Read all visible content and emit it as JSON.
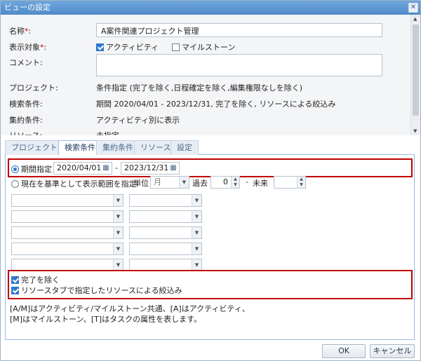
{
  "window": {
    "title": "ビューの設定",
    "close": "✕"
  },
  "form": {
    "name_label": "名称",
    "name_value": "A案件関連プロジェクト管理",
    "target_label": "表示対象",
    "target_options": [
      {
        "label": "アクティビティ",
        "checked": true
      },
      {
        "label": "マイルストーン",
        "checked": false
      }
    ],
    "comment_label": "コメント:",
    "project_label": "プロジェクト:",
    "project_value": "条件指定 (完了を除く,日程確定を除く,編集権限なしを除く)",
    "search_label": "検索条件:",
    "search_value": "期間 2020/04/01 - 2023/12/31, 完了を除く, リソースによる絞込み",
    "aggregate_label": "集約条件:",
    "aggregate_value": "アクティビティ別に表示",
    "resource_label": "リソース:",
    "resource_value": "未指定",
    "required_mark": "*"
  },
  "tabs": [
    "プロジェクト",
    "検索条件",
    "集約条件",
    "リソース",
    "設定"
  ],
  "active_tab": 1,
  "search": {
    "period_label": "期間指定",
    "date_from": "2020/04/01",
    "date_sep": "-",
    "date_to": "2023/12/31",
    "relative_label": "現在を基準として表示範囲を指定",
    "unit_label": "単位",
    "unit_value": "月",
    "past_label": "過去",
    "past_value": "0",
    "range_sep": "-",
    "future_label": "未来",
    "future_value": "",
    "exclude_done_label": "完了を除く",
    "exclude_done_checked": true,
    "resource_filter_label": "リソースタブで指定したリソースによる絞込み",
    "resource_filter_checked": true,
    "note_line1": "[A/M]はアクティビティ/マイルストーン共通、[A]はアクティビティ、",
    "note_line2": "[M]はマイルストーン、[T]はタスクの属性を表します。"
  },
  "buttons": {
    "ok": "OK",
    "cancel": "キャンセル"
  },
  "icons": {
    "calendar": "calendar-icon",
    "dropdown": "chevron-down-icon",
    "spin": "spinner-icon"
  },
  "colors": {
    "titlebar": "#5b95d0",
    "highlight": "#c00000",
    "accent": "#2f78c9"
  }
}
